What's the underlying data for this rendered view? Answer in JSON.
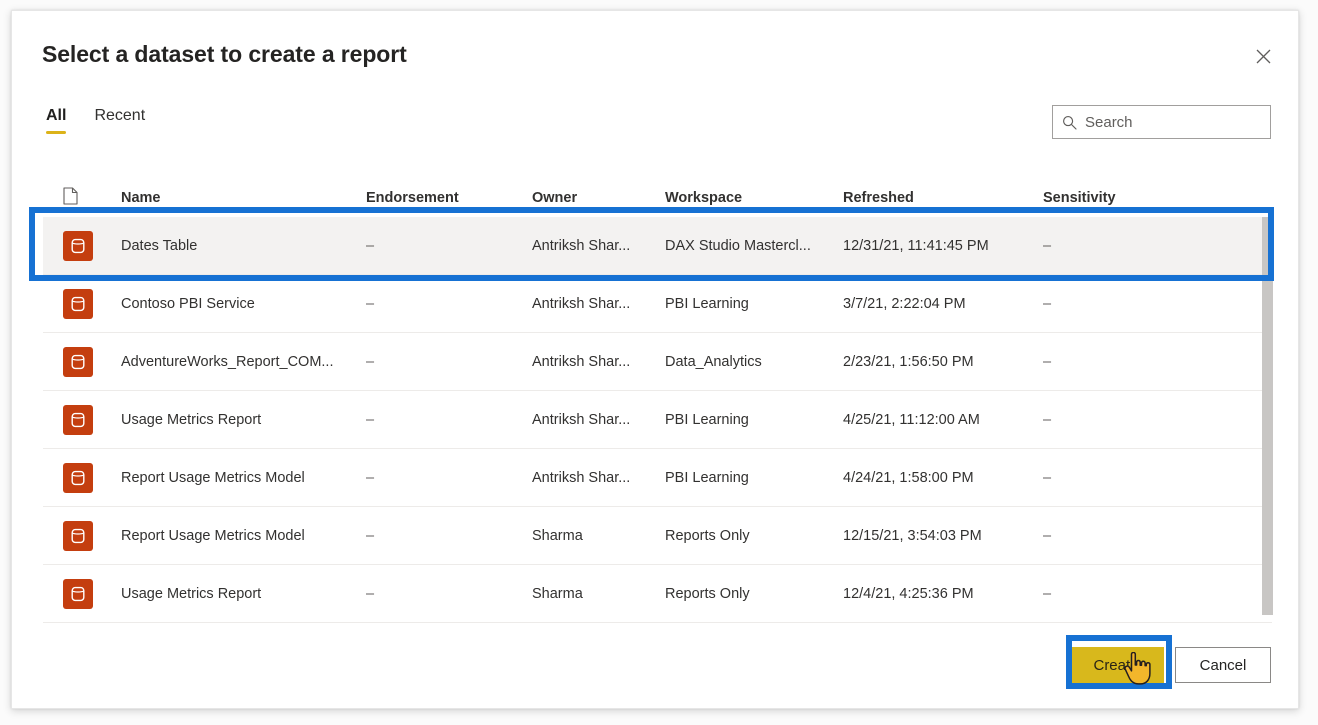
{
  "dialog": {
    "title": "Select a dataset to create a report",
    "close_icon": "close-icon"
  },
  "tabs": [
    {
      "label": "All",
      "active": true
    },
    {
      "label": "Recent",
      "active": false
    }
  ],
  "search": {
    "placeholder": "Search",
    "value": "",
    "icon": "search-icon"
  },
  "table": {
    "columns": [
      {
        "key": "icon",
        "label": ""
      },
      {
        "key": "name",
        "label": "Name"
      },
      {
        "key": "endorsement",
        "label": "Endorsement"
      },
      {
        "key": "owner",
        "label": "Owner"
      },
      {
        "key": "workspace",
        "label": "Workspace"
      },
      {
        "key": "refreshed",
        "label": "Refreshed"
      },
      {
        "key": "sensitivity",
        "label": "Sensitivity"
      }
    ],
    "header_icon": "file-icon",
    "rows": [
      {
        "icon": "dataset-icon",
        "name": "Dates Table",
        "endorsement": "–",
        "owner": "Antriksh Shar...",
        "workspace": "DAX Studio Mastercl...",
        "refreshed": "12/31/21, 11:41:45 PM",
        "sensitivity": "–",
        "selected": true
      },
      {
        "icon": "dataset-icon",
        "name": "Contoso PBI Service",
        "endorsement": "–",
        "owner": "Antriksh Shar...",
        "workspace": "PBI Learning",
        "refreshed": "3/7/21, 2:22:04 PM",
        "sensitivity": "–",
        "selected": false
      },
      {
        "icon": "dataset-icon",
        "name": "AdventureWorks_Report_COM...",
        "endorsement": "–",
        "owner": "Antriksh Shar...",
        "workspace": "Data_Analytics",
        "refreshed": "2/23/21, 1:56:50 PM",
        "sensitivity": "–",
        "selected": false
      },
      {
        "icon": "dataset-icon",
        "name": "Usage Metrics Report",
        "endorsement": "–",
        "owner": "Antriksh Shar...",
        "workspace": "PBI Learning",
        "refreshed": "4/25/21, 11:12:00 AM",
        "sensitivity": "–",
        "selected": false
      },
      {
        "icon": "dataset-icon",
        "name": "Report Usage Metrics Model",
        "endorsement": "–",
        "owner": "Antriksh Shar...",
        "workspace": "PBI Learning",
        "refreshed": "4/24/21, 1:58:00 PM",
        "sensitivity": "–",
        "selected": false
      },
      {
        "icon": "dataset-icon",
        "name": "Report Usage Metrics Model",
        "endorsement": "–",
        "owner": "Sharma",
        "workspace": "Reports Only",
        "refreshed": "12/15/21, 3:54:03 PM",
        "sensitivity": "–",
        "selected": false
      },
      {
        "icon": "dataset-icon",
        "name": "Usage Metrics Report",
        "endorsement": "–",
        "owner": "Sharma",
        "workspace": "Reports Only",
        "refreshed": "12/4/21, 4:25:36 PM",
        "sensitivity": "–",
        "selected": false
      }
    ]
  },
  "footer": {
    "create_label": "Create",
    "cancel_label": "Cancel"
  },
  "colors": {
    "accent_gold": "#d8b81c",
    "dataset_orange": "#c43e0f",
    "annotation_blue": "#1671d3",
    "selected_row": "#f3f2f1",
    "tab_underline": "#dcb319"
  }
}
